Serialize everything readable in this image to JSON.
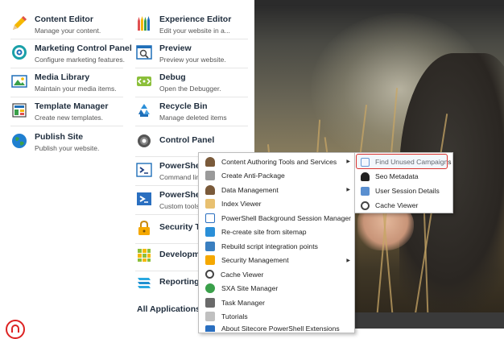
{
  "launchpad": {
    "left_column": [
      {
        "name": "Content Editor",
        "desc": "Manage your content.",
        "icon": "pencil-icon"
      },
      {
        "name": "Marketing Control Panel",
        "desc": "Configure marketing features.",
        "icon": "target-icon"
      },
      {
        "name": "Media Library",
        "desc": "Maintain your media items.",
        "icon": "media-library-icon"
      },
      {
        "name": "Template Manager",
        "desc": "Create new templates.",
        "icon": "template-icon"
      },
      {
        "name": "Publish Site",
        "desc": "Publish your website.",
        "icon": "globe-icon"
      }
    ],
    "right_column": [
      {
        "name": "Experience Editor",
        "desc": "Edit your website in a...",
        "icon": "crayons-icon"
      },
      {
        "name": "Preview",
        "desc": "Preview your website.",
        "icon": "preview-icon"
      },
      {
        "name": "Debug",
        "desc": "Open the Debugger.",
        "icon": "debug-icon"
      },
      {
        "name": "Recycle Bin",
        "desc": "Manage deleted items",
        "icon": "recycle-icon"
      },
      {
        "name": "Control Panel",
        "desc": "",
        "icon": "gear-icon"
      },
      {
        "name": "PowerShell",
        "desc": "Command lin",
        "icon": "powershell-console-icon"
      },
      {
        "name": "PowerShell",
        "desc": "Custom tools",
        "icon": "powershell-ise-icon"
      },
      {
        "name": "Security To",
        "desc": "",
        "icon": "lock-icon"
      },
      {
        "name": "Developme",
        "desc": "",
        "icon": "cubes-icon"
      },
      {
        "name": "Reporting T",
        "desc": "",
        "icon": "reporting-icon"
      }
    ],
    "all_applications": "All Applications"
  },
  "context_menu": {
    "items": [
      {
        "label": "Content Authoring Tools and Services",
        "icon": "person-icon",
        "has_submenu": true
      },
      {
        "label": "Create Anti-Package",
        "icon": "package-icon",
        "has_submenu": false
      },
      {
        "label": "Data Management",
        "icon": "person-icon",
        "has_submenu": true
      },
      {
        "label": "Index Viewer",
        "icon": "index-icon",
        "has_submenu": false
      },
      {
        "label": "PowerShell Background Session Manager",
        "icon": "session-icon",
        "has_submenu": false
      },
      {
        "label": "Re-create site from sitemap",
        "icon": "sitemap-icon",
        "has_submenu": false
      },
      {
        "label": "Rebuild script integration points",
        "icon": "rebuild-icon",
        "has_submenu": false
      },
      {
        "label": "Security Management",
        "icon": "lock-icon",
        "has_submenu": true
      },
      {
        "label": "Cache Viewer",
        "icon": "search-icon",
        "has_submenu": false
      },
      {
        "label": "SXA Site Manager",
        "icon": "sxa-icon",
        "has_submenu": false
      },
      {
        "label": "Task Manager",
        "icon": "task-icon",
        "has_submenu": false
      },
      {
        "label": "Tutorials",
        "icon": "tutorials-icon",
        "has_submenu": false
      },
      {
        "label": "About Sitecore PowerShell Extensions",
        "icon": "info-icon",
        "has_submenu": false
      }
    ]
  },
  "submenu": {
    "items": [
      {
        "label": "Find Unused Campaigns",
        "icon": "campaign-icon",
        "highlighted": true
      },
      {
        "label": "Seo Metadata",
        "icon": "person-icon",
        "highlighted": false
      },
      {
        "label": "User Session Details",
        "icon": "user-session-icon",
        "highlighted": false
      },
      {
        "label": "Cache Viewer",
        "icon": "search-icon",
        "highlighted": false
      }
    ]
  },
  "colors": {
    "highlight_border": "#d9322e",
    "text_dark": "#1f2d3d"
  }
}
